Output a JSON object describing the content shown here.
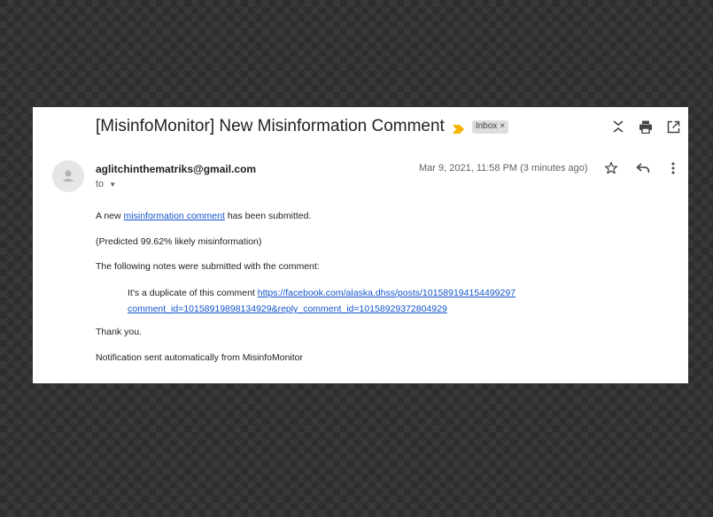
{
  "email": {
    "subject": "[MisinfoMonitor] New Misinformation Comment",
    "label": "Inbox",
    "label_remove": "×",
    "sender": "aglitchinthematriks@gmail.com",
    "to": "to",
    "timestamp": "Mar 9, 2021, 11:58 PM (3 minutes ago)",
    "body": {
      "line1_prefix": "A new ",
      "line1_link": "misinformation comment",
      "line1_suffix": " has been submitted.",
      "predicted": "(Predicted 99.62% likely misinformation)",
      "notes_intro": "The following notes were submitted with the comment:",
      "quote_prefix": "It's a duplicate of this comment ",
      "quote_link_line1": "https://facebook.com/alaska.dhss/posts/101589194154499297",
      "quote_link_line2": "comment_id=10158919898134929&reply_comment_id=10158929372804929",
      "thanks": "Thank you.",
      "footer": "Notification sent automatically from MisinfoMonitor"
    }
  },
  "icons": {
    "important": "important-marker-icon",
    "expand_collapse": "unfold-icon",
    "print": "print-icon",
    "open_new_window": "open-in-new-icon",
    "star": "star-icon",
    "reply": "reply-icon",
    "more": "more-vert-icon",
    "avatar": "person-icon"
  },
  "colors": {
    "important_marker": "#f4b400",
    "link": "#1155cc",
    "label_chip": "#dddddd"
  }
}
